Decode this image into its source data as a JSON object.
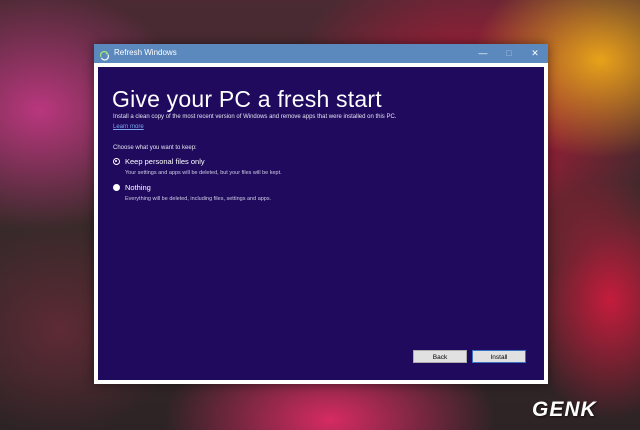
{
  "window": {
    "title": "Refresh Windows",
    "controls": {
      "minimize": "—",
      "maximize": "□",
      "close": "✕"
    }
  },
  "main": {
    "heading": "Give your PC a fresh start",
    "description": "Install a clean copy of the most recent version of Windows and remove apps that were installed on this PC.",
    "learn_more": "Learn more",
    "choose_prompt": "Choose what you want to keep:",
    "options": [
      {
        "label": "Keep personal files only",
        "description": "Your settings and apps will be deleted, but your files will be kept.",
        "selected": true
      },
      {
        "label": "Nothing",
        "description": "Everything will be deleted, including files, settings and apps.",
        "selected": false
      }
    ]
  },
  "footer": {
    "back_label": "Back",
    "install_label": "Install"
  },
  "watermark": "GENK",
  "colors": {
    "titlebar": "#5b88bd",
    "content_bg": "#1f0a5e",
    "link": "#7aa7ef"
  }
}
